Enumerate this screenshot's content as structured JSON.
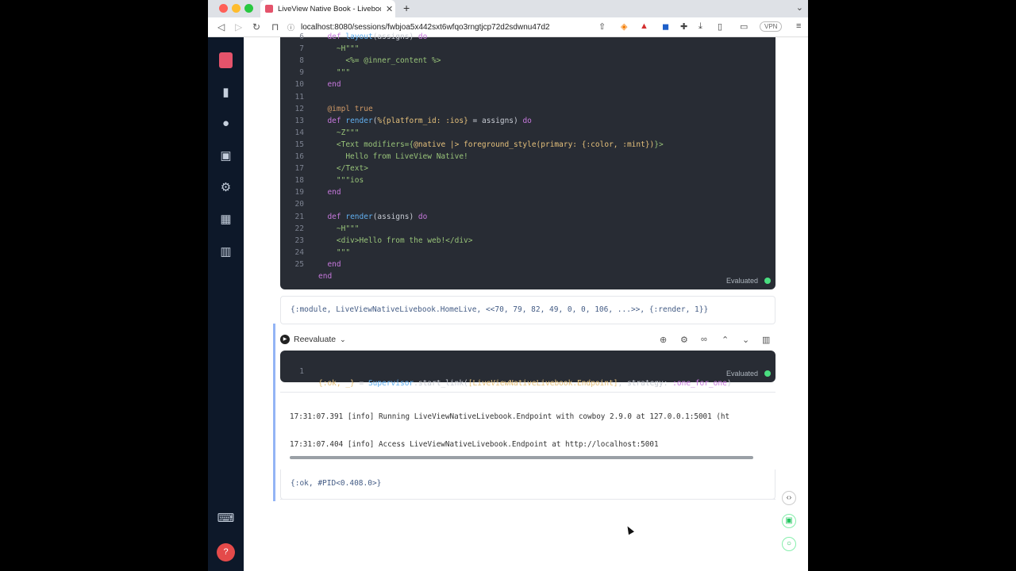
{
  "browser": {
    "tab_title": "LiveView Native Book - Livebook",
    "url": "localhost:8080/sessions/fwbjoa5x442sxt6wfqo3rngtjcp72d2sdwnu47d2",
    "vpn_label": "VPN"
  },
  "code_cell_top": {
    "lines": [
      {
        "n": "6",
        "html": "  <span class=\"kw\">def</span> <span class=\"fn\">layout</span>(assigns) <span class=\"kw\">do</span>"
      },
      {
        "n": "7",
        "html": "    <span class=\"st\">~H\"\"\"</span>"
      },
      {
        "n": "8",
        "html": "      <span class=\"st\">&lt;%= @inner_content %&gt;</span>"
      },
      {
        "n": "9",
        "html": "    <span class=\"st\">\"\"\"</span>"
      },
      {
        "n": "10",
        "html": "  <span class=\"kw\">end</span>"
      },
      {
        "n": "11",
        "html": ""
      },
      {
        "n": "12",
        "html": "  <span class=\"at2\">@impl</span> <span class=\"at2\">true</span>"
      },
      {
        "n": "13",
        "html": "  <span class=\"kw\">def</span> <span class=\"fn\">render</span>(<span class=\"at\">%{platform_id: :ios}</span> = assigns) <span class=\"kw\">do</span>"
      },
      {
        "n": "14",
        "html": "    <span class=\"st\">~Z\"\"\"</span>"
      },
      {
        "n": "15",
        "html": "    <span class=\"st\">&lt;Text modifiers={</span><span class=\"at\">@native |&gt; foreground_style(primary: {:color, :mint})</span><span class=\"st\">}&gt;</span>"
      },
      {
        "n": "16",
        "html": "      <span class=\"st\">Hello from LiveView Native!</span>"
      },
      {
        "n": "17",
        "html": "    <span class=\"st\">&lt;/Text&gt;</span>"
      },
      {
        "n": "18",
        "html": "    <span class=\"st\">\"\"\"ios</span>"
      },
      {
        "n": "19",
        "html": "  <span class=\"kw\">end</span>"
      },
      {
        "n": "20",
        "html": ""
      },
      {
        "n": "21",
        "html": "  <span class=\"kw\">def</span> <span class=\"fn\">render</span>(assigns) <span class=\"kw\">do</span>"
      },
      {
        "n": "22",
        "html": "    <span class=\"st\">~H\"\"\"</span>"
      },
      {
        "n": "23",
        "html": "    <span class=\"st\">&lt;div&gt;Hello from the web!&lt;/div&gt;</span>"
      },
      {
        "n": "24",
        "html": "    <span class=\"st\">\"\"\"</span>"
      },
      {
        "n": "25",
        "html": "  <span class=\"kw\">end</span>"
      },
      {
        "n": "",
        "html": "<span class=\"kw\">end</span>"
      }
    ],
    "status": "Evaluated"
  },
  "output_top": "{:module, LiveViewNativeLivebook.HomeLive, <<70, 79, 82, 49, 0, 0, 106, ...>>, {:render, 1}}",
  "cell_toolbar": {
    "reevaluate_label": "Reevaluate"
  },
  "code_cell_bottom": {
    "line_number": "1",
    "code": "{:ok, _} = Supervisor.start_link([LiveViewNativeLivebook.Endpoint], strategy: :one_for_one)",
    "status": "Evaluated"
  },
  "logs": [
    "17:31:07.391 [info] Running LiveViewNativeLivebook.Endpoint with cowboy 2.9.0 at 127.0.0.1:5001 (ht",
    "17:31:07.404 [info] Access LiveViewNativeLivebook.Endpoint at http://localhost:5001"
  ],
  "output_bottom": "{:ok, #PID<0.408.0>}"
}
